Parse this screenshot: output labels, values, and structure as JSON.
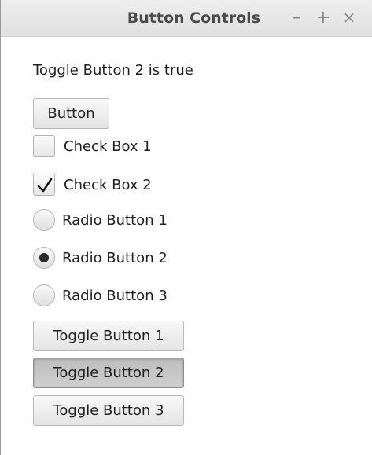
{
  "window": {
    "title": "Button Controls",
    "minimize_glyph": "–",
    "maximize_glyph": "+",
    "close_glyph": "×"
  },
  "status_text": "Toggle Button 2 is true",
  "button": {
    "label": "Button"
  },
  "checkboxes": [
    {
      "label": "Check Box 1",
      "checked": false
    },
    {
      "label": "Check Box 2",
      "checked": true
    }
  ],
  "radios": [
    {
      "label": "Radio Button 1",
      "selected": false
    },
    {
      "label": "Radio Button 2",
      "selected": true
    },
    {
      "label": "Radio Button 3",
      "selected": false
    }
  ],
  "toggles": [
    {
      "label": "Toggle Button 1",
      "selected": false
    },
    {
      "label": "Toggle Button 2",
      "selected": true
    },
    {
      "label": "Toggle Button 3",
      "selected": false
    }
  ],
  "icons": {
    "checkmark": "checkmark-icon"
  }
}
